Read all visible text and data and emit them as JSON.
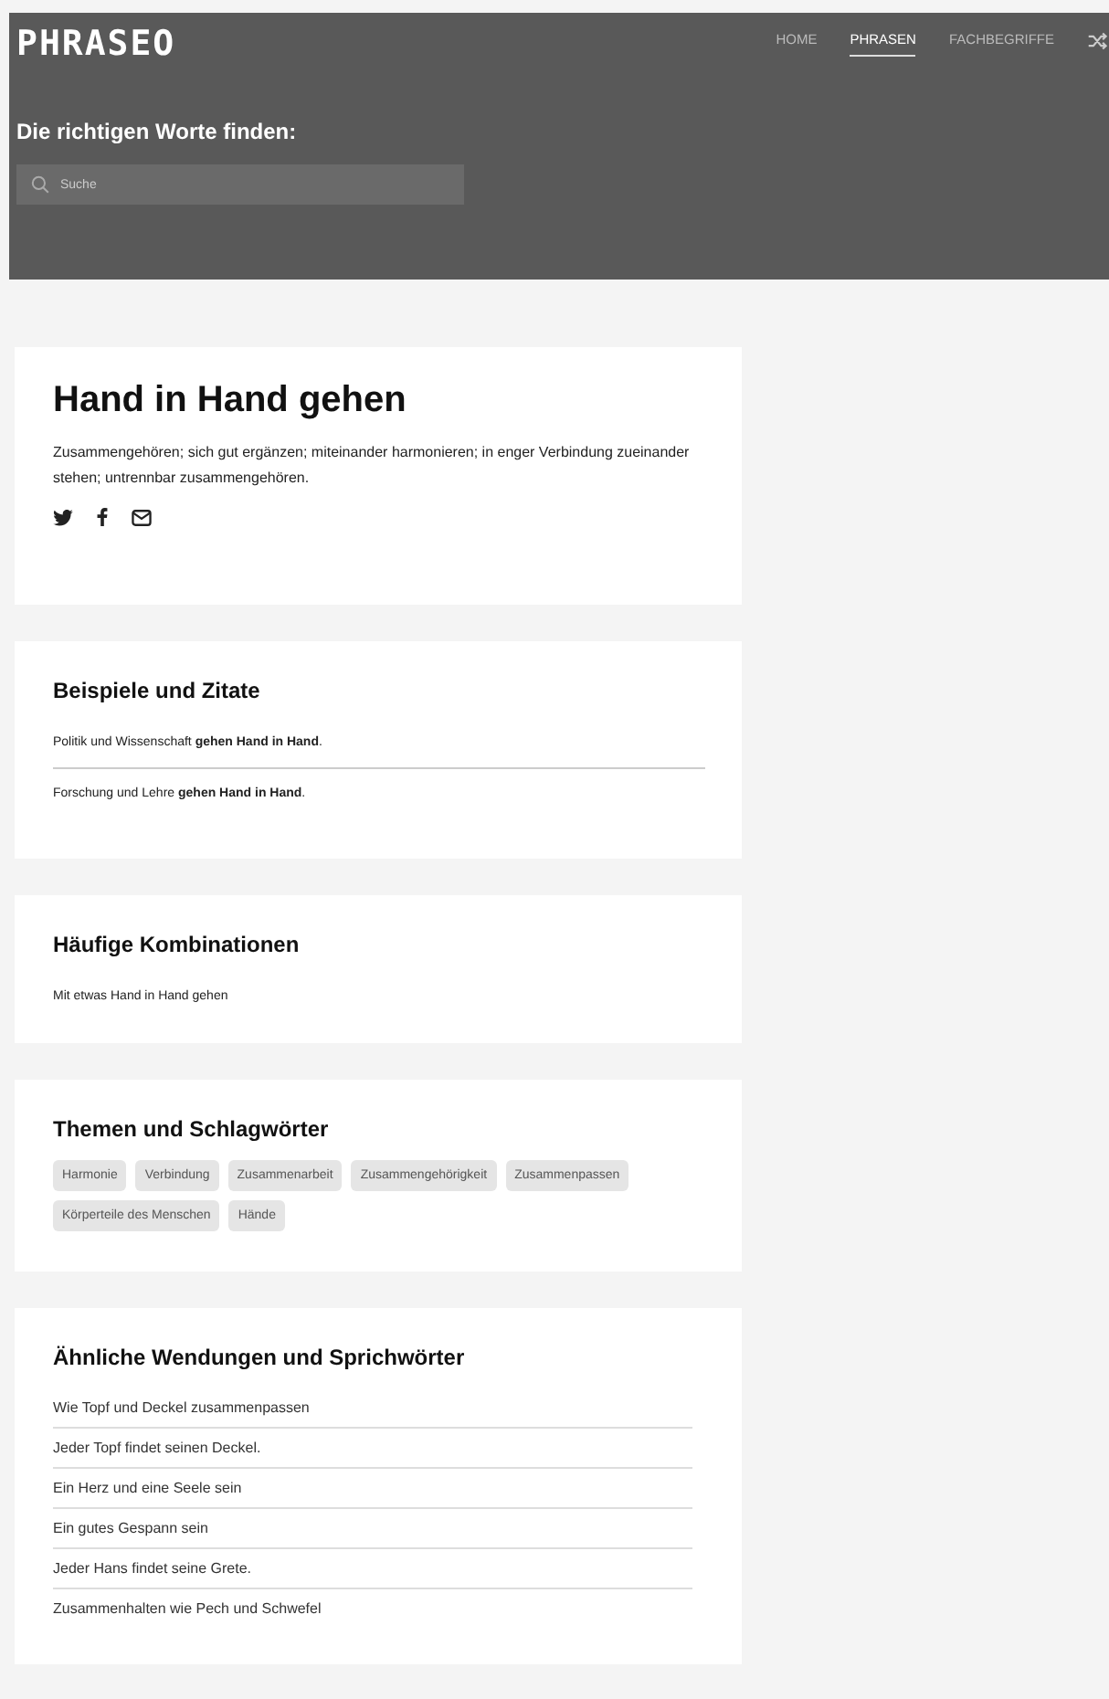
{
  "header": {
    "logo": "PHRASEO",
    "nav": [
      {
        "label": "HOME",
        "selected": false
      },
      {
        "label": "PHRASEN",
        "selected": true
      },
      {
        "label": "FACHBEGRIFFE",
        "selected": false
      }
    ],
    "tagline": "Die richtigen Worte finden:",
    "search": {
      "placeholder": "Suche"
    }
  },
  "phrase": {
    "title": "Hand in Hand gehen",
    "definition": "Zusammengehören; sich gut ergänzen; miteinander harmonieren; in enger Verbindung zueinander stehen; untrennbar zusammengehören.",
    "share": [
      {
        "kind": "twitter"
      },
      {
        "kind": "facebook"
      },
      {
        "kind": "mail"
      }
    ]
  },
  "examples": {
    "title": "Beispiele und Zitate",
    "items": [
      "Politik und Wissenschaft **gehen Hand in Hand**.",
      "Forschung und Lehre **gehen Hand in Hand**."
    ]
  },
  "combinations": {
    "title": "Häufige Kombinationen",
    "items": [
      "Mit etwas Hand in Hand gehen"
    ]
  },
  "topics": {
    "title": "Themen und Schlagwörter",
    "tags": [
      "Harmonie",
      "Verbindung",
      "Zusammenarbeit",
      "Zusammengehörigkeit",
      "Zusammenpassen",
      "Körperteile des Menschen",
      "Hände"
    ]
  },
  "similar": {
    "title": "Ähnliche Wendungen und Sprichwörter",
    "items": [
      "Wie Topf und Deckel zusammenpassen",
      "Jeder Topf findet seinen Deckel.",
      "Ein Herz und eine Seele sein",
      "Ein gutes Gespann sein",
      "Jeder Hans findet seine Grete.",
      "Zusammenhalten wie Pech und Schwefel"
    ]
  }
}
